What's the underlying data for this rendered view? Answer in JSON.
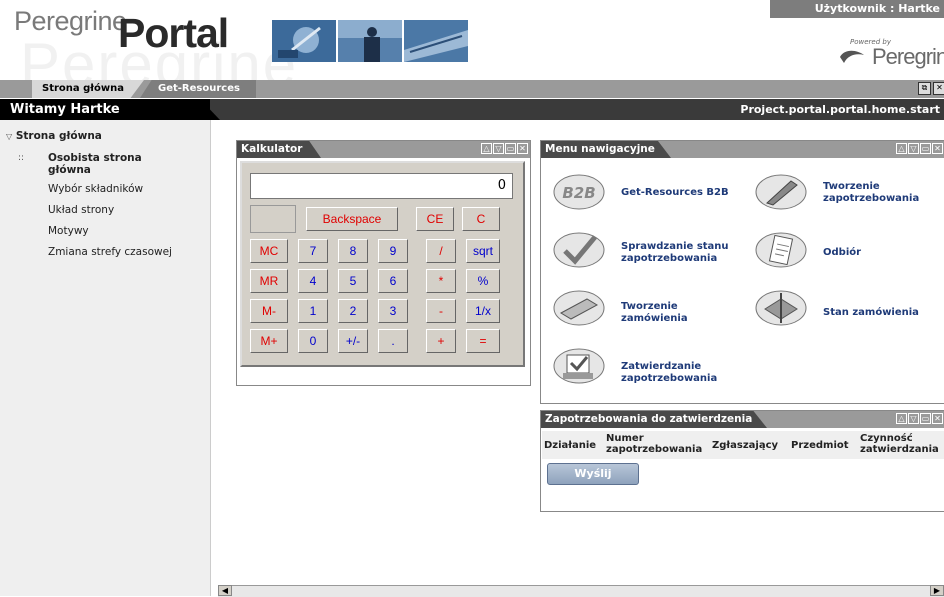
{
  "header": {
    "logo_part1": "Peregrine",
    "logo_part2": "Portal",
    "user_label": "Użytkownik : Hartke",
    "powered_by": "Powered by",
    "brand": "Peregrine"
  },
  "tabs": [
    {
      "label": "Strona główna"
    },
    {
      "label": "Get-Resources"
    }
  ],
  "welcome": {
    "title": "Witamy Hartke",
    "path": "Project.portal.portal.home.start"
  },
  "sidebar": {
    "section": "Strona główna",
    "items": [
      {
        "label": "Osobista strona główna",
        "active": true
      },
      {
        "label": "Wybór składników"
      },
      {
        "label": "Układ strony"
      },
      {
        "label": "Motywy"
      },
      {
        "label": "Zmiana strefy czasowej"
      }
    ]
  },
  "calculator": {
    "title": "Kalkulator",
    "display": "0",
    "buttons": {
      "backspace": "Backspace",
      "ce": "CE",
      "c": "C",
      "mc": "MC",
      "mr": "MR",
      "ms": "M-",
      "mplus": "M+",
      "n7": "7",
      "n8": "8",
      "n9": "9",
      "div": "/",
      "sqrt": "sqrt",
      "n4": "4",
      "n5": "5",
      "n6": "6",
      "mul": "*",
      "pct": "%",
      "n1": "1",
      "n2": "2",
      "n3": "3",
      "sub": "-",
      "inv": "1/x",
      "n0": "0",
      "sign": "+/-",
      "dot": ".",
      "add": "+",
      "eq": "="
    }
  },
  "nav_menu": {
    "title": "Menu nawigacyjne",
    "items": [
      {
        "label": "Get-Resources B2B",
        "icon": "b2b-icon"
      },
      {
        "label": "Tworzenie zapotrzebowania",
        "icon": "pen-icon"
      },
      {
        "label": "Sprawdzanie stanu zapotrzebowania",
        "icon": "check-icon"
      },
      {
        "label": "Odbiór",
        "icon": "receipt-icon"
      },
      {
        "label": "Tworzenie zamówienia",
        "icon": "order-icon"
      },
      {
        "label": "Stan zamówienia",
        "icon": "status-icon"
      },
      {
        "label": "Zatwierdzanie zapotrzebowania",
        "icon": "approve-icon"
      }
    ]
  },
  "approvals": {
    "title": "Zapotrzebowania do zatwierdzenia",
    "columns": [
      "Działanie",
      "Numer zapotrzebowania",
      "Zgłaszający",
      "Przedmiot",
      "Czynność zatwierdzania"
    ],
    "submit": "Wyślij"
  },
  "colors": {
    "title_bar": "#4a4a4a",
    "link": "#1e3a78",
    "calc_red": "#e00000",
    "calc_blue": "#0000cc"
  }
}
